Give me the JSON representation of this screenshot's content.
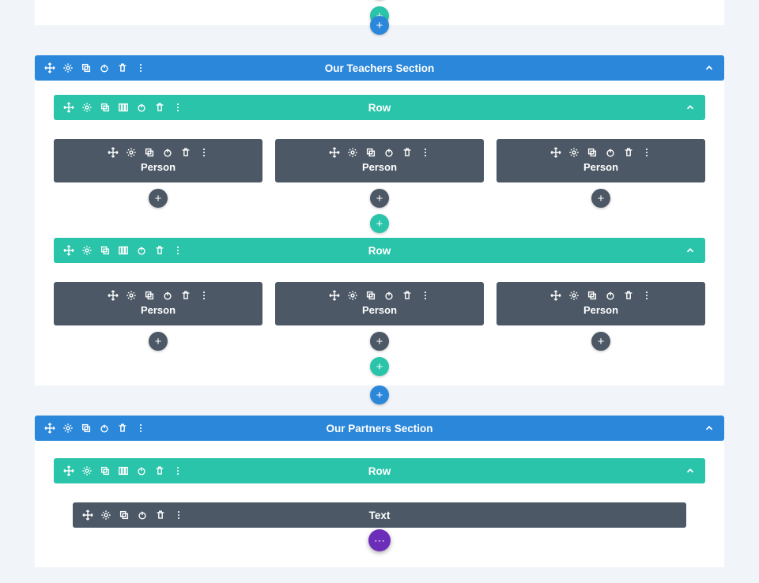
{
  "top_partial": {
    "add_button": "+"
  },
  "sections": [
    {
      "title": "Our Teachers Section",
      "add_row_label": "+",
      "add_section_label": "+",
      "rows": [
        {
          "title": "Row",
          "add_row_label": "+",
          "modules": [
            {
              "label": "Person",
              "add": "+"
            },
            {
              "label": "Person",
              "add": "+"
            },
            {
              "label": "Person",
              "add": "+"
            }
          ]
        },
        {
          "title": "Row",
          "add_row_label": "+",
          "modules": [
            {
              "label": "Person",
              "add": "+"
            },
            {
              "label": "Person",
              "add": "+"
            },
            {
              "label": "Person",
              "add": "+"
            }
          ]
        }
      ]
    },
    {
      "title": "Our Partners Section",
      "rows": [
        {
          "title": "Row",
          "modules_full": [
            {
              "label": "Text"
            }
          ]
        }
      ]
    }
  ],
  "fab_label": "⋯"
}
